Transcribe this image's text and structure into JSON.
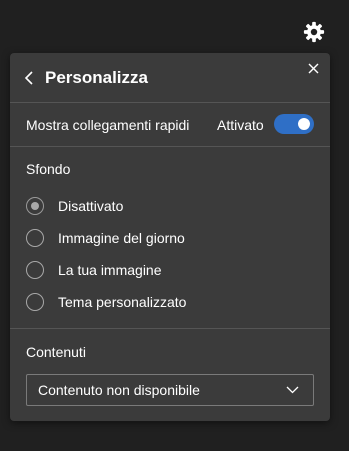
{
  "gear": {
    "icon": "gear-icon"
  },
  "panel": {
    "title": "Personalizza",
    "back_icon": "chevron-left-icon",
    "close_icon": "close-icon",
    "shortcuts": {
      "label": "Mostra collegamenti rapidi",
      "status": "Attivato",
      "enabled": true
    },
    "background": {
      "heading": "Sfondo",
      "options": [
        {
          "label": "Disattivato",
          "selected": true
        },
        {
          "label": "Immagine del giorno",
          "selected": false
        },
        {
          "label": "La tua immagine",
          "selected": false
        },
        {
          "label": "Tema personalizzato",
          "selected": false
        }
      ]
    },
    "content": {
      "heading": "Contenuti",
      "selected": "Contenuto non disponibile",
      "chevron_icon": "chevron-down-icon"
    }
  },
  "colors": {
    "page_bg": "#202020",
    "panel_bg": "#3b3b3b",
    "toggle_on": "#2f6fc6",
    "divider": "#555555"
  }
}
